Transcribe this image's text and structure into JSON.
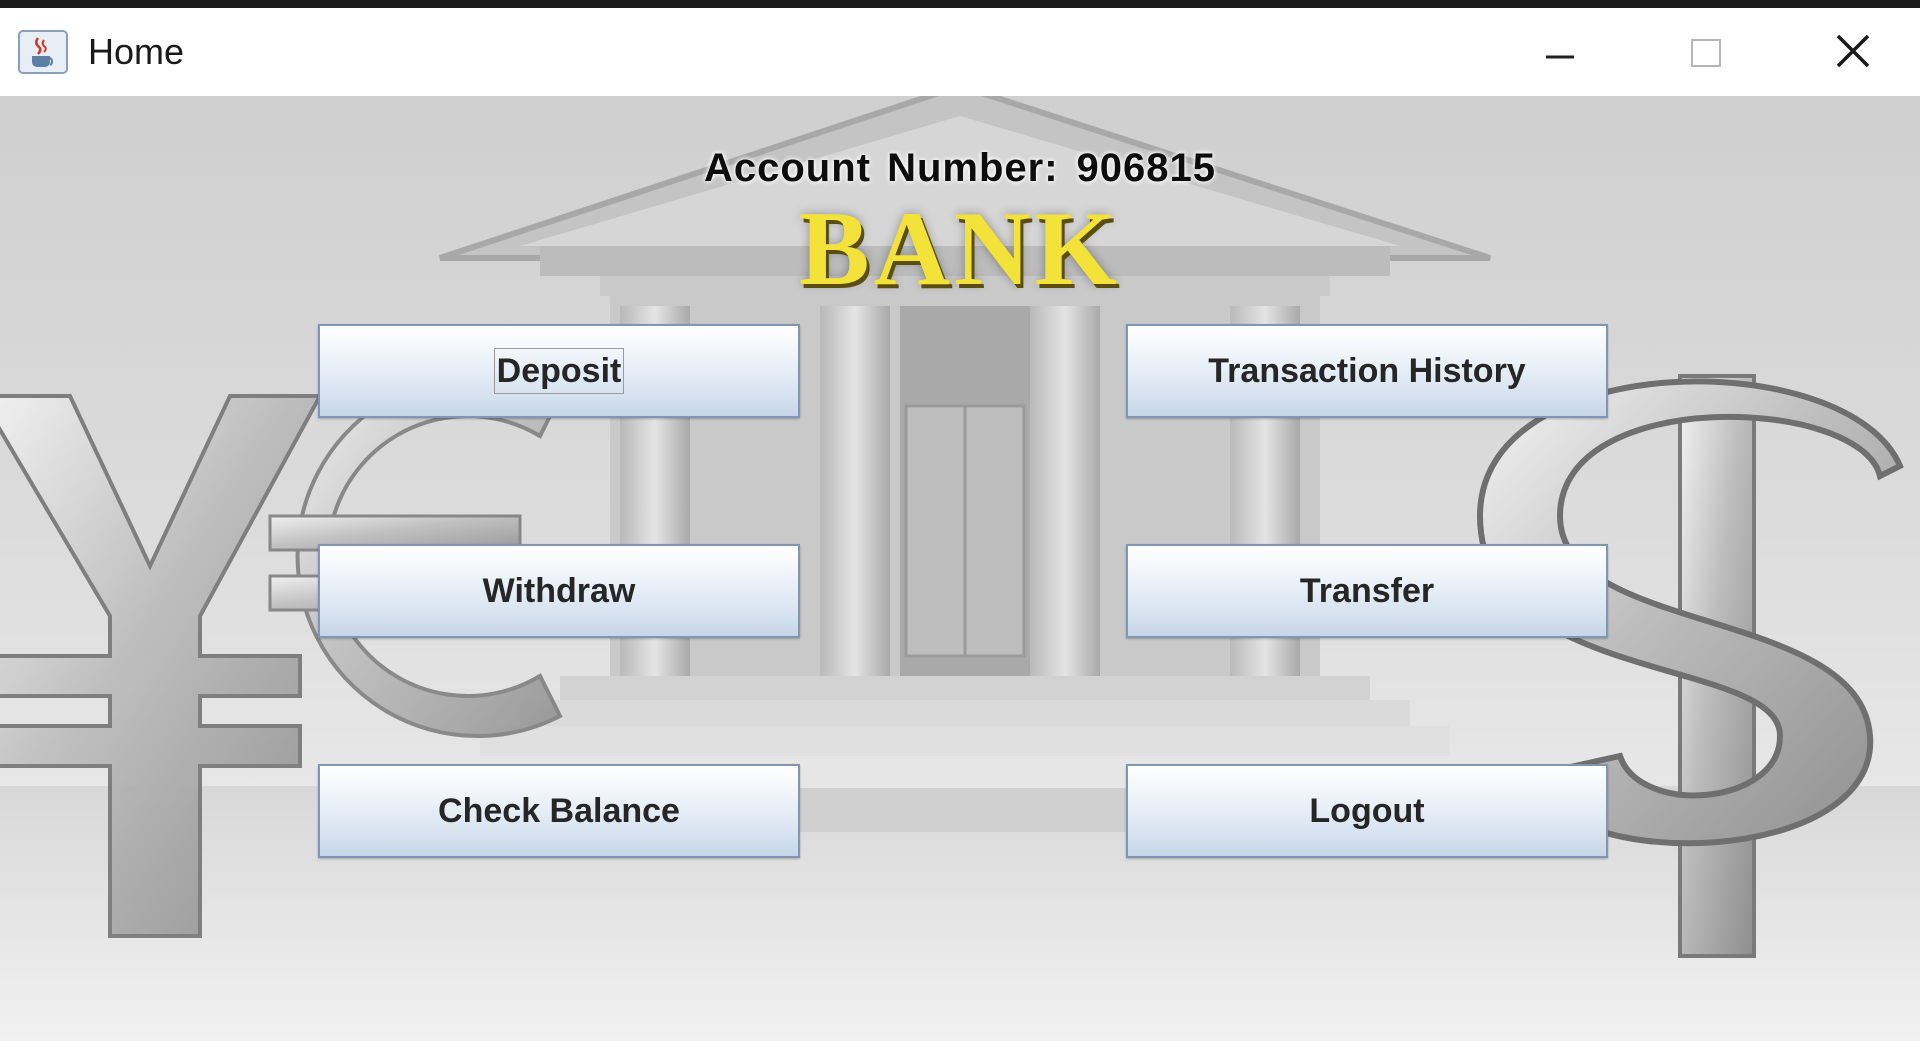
{
  "window": {
    "title": "Home",
    "icons": {
      "app": "java-coffee-cup-icon",
      "minimize": "minimize-icon",
      "maximize": "maximize-icon",
      "close": "close-icon"
    }
  },
  "header": {
    "account_label": "Account Number:",
    "account_number": "906815",
    "bank_logo": "BANK"
  },
  "buttons": {
    "deposit": "Deposit",
    "transaction_history": "Transaction History",
    "withdraw": "Withdraw",
    "transfer": "Transfer",
    "check_balance": "Check Balance",
    "logout": "Logout"
  },
  "background": {
    "image": "bank-building-with-currency-symbols",
    "symbols": [
      "yen-icon",
      "euro-icon",
      "dollar-icon"
    ]
  },
  "colors": {
    "logo_yellow": "#f3e23a",
    "button_border": "#7f97b3"
  }
}
